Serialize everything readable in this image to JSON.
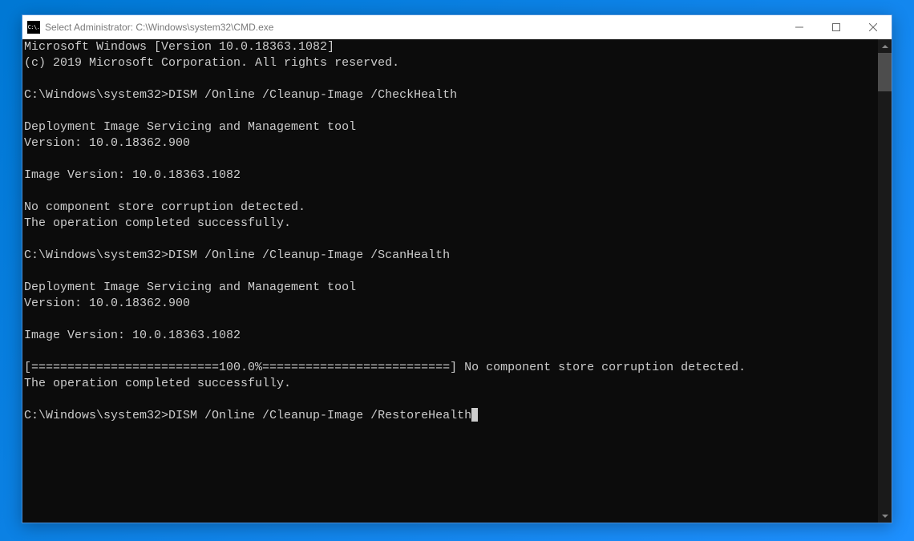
{
  "window": {
    "title": "Select Administrator: C:\\Windows\\system32\\CMD.exe",
    "icon_text": "C:\\."
  },
  "terminal": {
    "lines": [
      "Microsoft Windows [Version 10.0.18363.1082]",
      "(c) 2019 Microsoft Corporation. All rights reserved.",
      "",
      "C:\\Windows\\system32>DISM /Online /Cleanup-Image /CheckHealth",
      "",
      "Deployment Image Servicing and Management tool",
      "Version: 10.0.18362.900",
      "",
      "Image Version: 10.0.18363.1082",
      "",
      "No component store corruption detected.",
      "The operation completed successfully.",
      "",
      "C:\\Windows\\system32>DISM /Online /Cleanup-Image /ScanHealth",
      "",
      "Deployment Image Servicing and Management tool",
      "Version: 10.0.18362.900",
      "",
      "Image Version: 10.0.18363.1082",
      "",
      "[==========================100.0%==========================] No component store corruption detected.",
      "The operation completed successfully.",
      ""
    ],
    "current_prompt": "C:\\Windows\\system32>DISM /Online /Cleanup-Image /RestoreHealth"
  }
}
